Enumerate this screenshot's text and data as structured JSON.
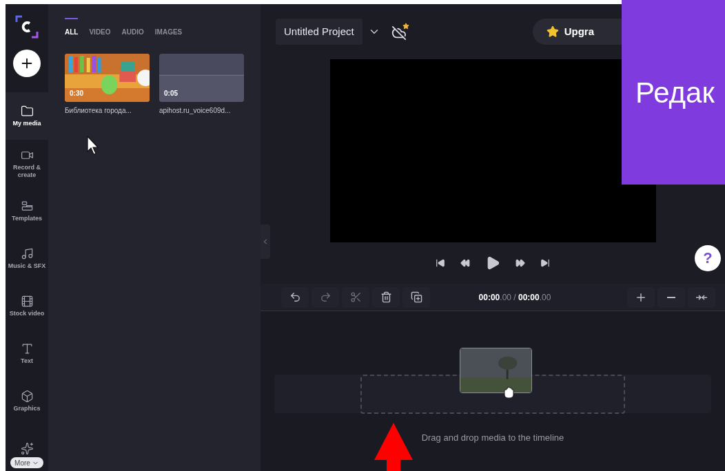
{
  "sidebar": {
    "items": [
      {
        "kind": "folder",
        "label": "My media",
        "selected": true
      },
      {
        "kind": "camera",
        "label": "Record & create",
        "selected": false
      },
      {
        "kind": "templates",
        "label": "Templates",
        "selected": false
      },
      {
        "kind": "music",
        "label": "Music & SFX",
        "selected": false
      },
      {
        "kind": "film",
        "label": "Stock video",
        "selected": false
      },
      {
        "kind": "text",
        "label": "Text",
        "selected": false
      },
      {
        "kind": "cube",
        "label": "Graphics",
        "selected": false
      },
      {
        "kind": "sparkles",
        "selected": false
      }
    ],
    "more": "More"
  },
  "media_tabs": [
    {
      "label": "ALL",
      "selected": true
    },
    {
      "label": "VIDEO",
      "selected": false
    },
    {
      "label": "AUDIO",
      "selected": false
    },
    {
      "label": "IMAGES",
      "selected": false
    }
  ],
  "media": [
    {
      "kind": "video",
      "duration": "0:30",
      "name": "Библиотека города..."
    },
    {
      "kind": "audio",
      "duration": "0:05",
      "name": "apihost.ru_voice609d..."
    }
  ],
  "project": {
    "title": "Untitled Project"
  },
  "upgrade": "Upgra",
  "help": "?",
  "overlay": "Редак",
  "time": {
    "current": "00:00",
    "current_fraction": ".00",
    "separator": "/",
    "total": "00:00",
    "total_fraction": ".00"
  },
  "timeline": {
    "hint": "Drag and drop media to the timeline"
  }
}
